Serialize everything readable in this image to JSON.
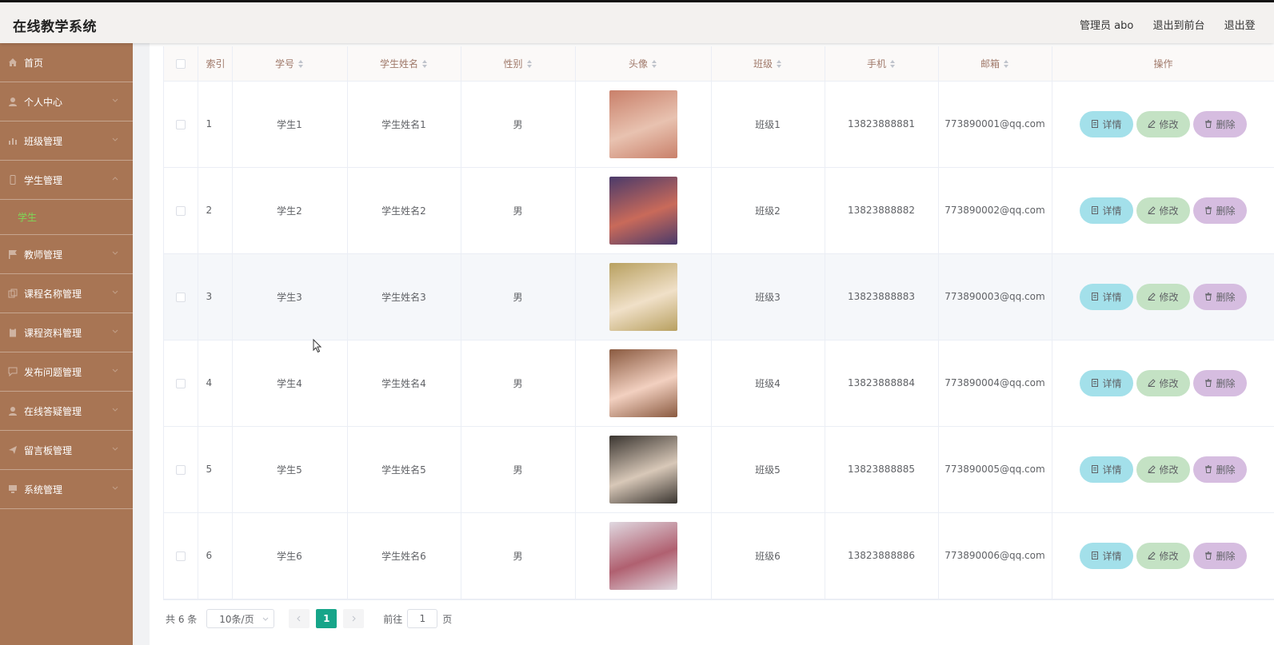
{
  "header": {
    "title": "在线教学系统",
    "admin_label": "管理员 abo",
    "exit_front": "退出到前台",
    "exit_login": "退出登"
  },
  "sidebar": {
    "items": [
      {
        "label": "首页",
        "icon": "home-icon"
      },
      {
        "label": "个人中心",
        "icon": "user-icon"
      },
      {
        "label": "班级管理",
        "icon": "chart-icon"
      },
      {
        "label": "学生管理",
        "icon": "phone-icon",
        "sub": [
          "学生"
        ]
      },
      {
        "label": "教师管理",
        "icon": "flag-icon"
      },
      {
        "label": "课程名称管理",
        "icon": "copy-icon"
      },
      {
        "label": "课程资料管理",
        "icon": "clipboard-icon"
      },
      {
        "label": "发布问题管理",
        "icon": "chat-icon"
      },
      {
        "label": "在线答疑管理",
        "icon": "user-icon"
      },
      {
        "label": "留言板管理",
        "icon": "send-icon"
      },
      {
        "label": "系统管理",
        "icon": "monitor-icon"
      }
    ]
  },
  "table": {
    "columns": [
      "索引",
      "学号",
      "学生姓名",
      "性别",
      "头像",
      "班级",
      "手机",
      "邮箱",
      "操作"
    ],
    "actions": {
      "detail": "详情",
      "edit": "修改",
      "delete": "删除"
    },
    "rows": [
      {
        "index": "1",
        "student_no": "学生1",
        "name": "学生姓名1",
        "gender": "男",
        "class": "班级1",
        "phone": "13823888881",
        "email": "773890001@qq.com",
        "avatar_colors": [
          "#c9806a",
          "#e8c2b0"
        ]
      },
      {
        "index": "2",
        "student_no": "学生2",
        "name": "学生姓名2",
        "gender": "男",
        "class": "班级2",
        "phone": "13823888882",
        "email": "773890002@qq.com",
        "avatar_colors": [
          "#4a3a6a",
          "#c96a5a"
        ]
      },
      {
        "index": "3",
        "student_no": "学生3",
        "name": "学生姓名3",
        "gender": "男",
        "class": "班级3",
        "phone": "13823888883",
        "email": "773890003@qq.com",
        "avatar_colors": [
          "#b8a060",
          "#f0e0c8"
        ]
      },
      {
        "index": "4",
        "student_no": "学生4",
        "name": "学生姓名4",
        "gender": "男",
        "class": "班级4",
        "phone": "13823888884",
        "email": "773890004@qq.com",
        "avatar_colors": [
          "#8a5a40",
          "#f2d0c0"
        ]
      },
      {
        "index": "5",
        "student_no": "学生5",
        "name": "学生姓名5",
        "gender": "男",
        "class": "班级5",
        "phone": "13823888885",
        "email": "773890005@qq.com",
        "avatar_colors": [
          "#3a3530",
          "#d8c8b8"
        ]
      },
      {
        "index": "6",
        "student_no": "学生6",
        "name": "学生姓名6",
        "gender": "男",
        "class": "班级6",
        "phone": "13823888886",
        "email": "773890006@qq.com",
        "avatar_colors": [
          "#e0d8e0",
          "#b06070"
        ]
      }
    ]
  },
  "pagination": {
    "total": "共 6 条",
    "page_size": "10条/页",
    "current_page": "1",
    "goto_prefix": "前往",
    "goto_value": "1",
    "goto_suffix": "页"
  },
  "colors": {
    "sidebar": "#a87554",
    "active_sub": "#7ed957",
    "pager_active": "#16a589",
    "btn_detail": "#a3e0ea",
    "btn_edit": "#c4e2c4",
    "btn_delete": "#d6bde0"
  }
}
